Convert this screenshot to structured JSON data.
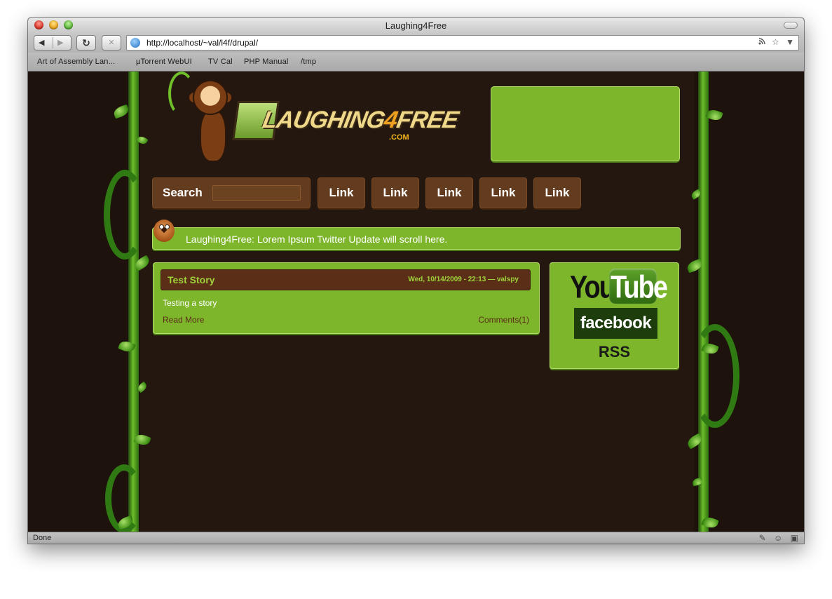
{
  "window": {
    "title": "Laughing4Free"
  },
  "toolbar": {
    "back": "◀",
    "forward": "▶",
    "reload": "↻",
    "stop": "✕",
    "url": "http://localhost/~val/l4f/drupal/",
    "rss_icon": "rss-icon",
    "star_icon": "star-icon",
    "dropdown_icon": "▼"
  },
  "bookmarks": [
    "Art of Assembly Lan...",
    "µTorrent WebUI",
    "TV Cal",
    "PHP Manual",
    "/tmp"
  ],
  "site": {
    "logo": {
      "text_a": "LAUGHING",
      "text_b": "4",
      "text_c": "FREE",
      "com": ".COM"
    },
    "nav": {
      "search_label": "Search",
      "links": [
        "Link",
        "Link",
        "Link",
        "Link",
        "Link"
      ]
    },
    "twitter": {
      "text": "Laughing4Free: Lorem Ipsum Twitter Update will scroll here."
    },
    "story": {
      "title": "Test Story",
      "meta": "Wed, 10/14/2009 - 22:13 — valspy",
      "body": "Testing a story",
      "read_more": "Read More",
      "comments": "Comments(1)"
    },
    "social": {
      "youtube_you": "You",
      "youtube_tube": "Tube",
      "facebook": "facebook",
      "rss": "RSS"
    }
  },
  "status": {
    "text": "Done"
  },
  "colors": {
    "page_bg": "#1e130c",
    "green": "#7db52b",
    "brown": "#633b1e",
    "dark_brown": "#5a2e17"
  }
}
